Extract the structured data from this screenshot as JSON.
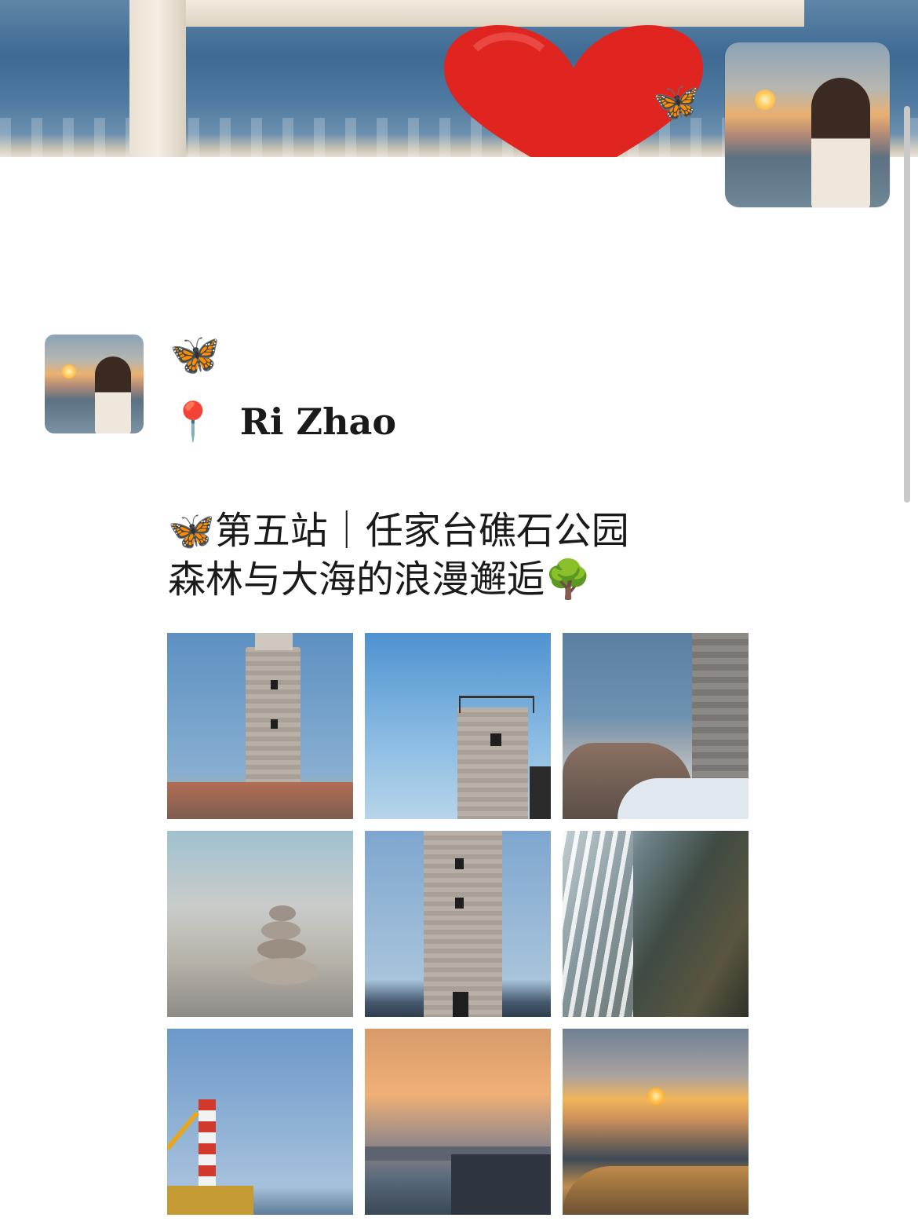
{
  "header": {
    "cover_decoration_icon": "butterfly-icon"
  },
  "post": {
    "name_icon": "butterfly-icon",
    "name_emoji": "🦋",
    "location": {
      "icon": "pin-icon",
      "pin_emoji": "📍",
      "text": "Ri Zhao"
    },
    "caption": {
      "line1_emoji": "🦋",
      "line1_text": "第五站｜任家台礁石公园",
      "line2_text": "森林与大海的浪漫邂逅",
      "line2_emoji": "🌳"
    },
    "photos": [
      {
        "subject": "lighthouse-stone-tower"
      },
      {
        "subject": "lighthouse-tower-top"
      },
      {
        "subject": "rocks-and-tower-wall"
      },
      {
        "subject": "stacked-stones"
      },
      {
        "subject": "lighthouse-close"
      },
      {
        "subject": "waves-on-rock"
      },
      {
        "subject": "red-white-lighthouse"
      },
      {
        "subject": "sunset-pier-fishing"
      },
      {
        "subject": "sunset-sea"
      }
    ]
  },
  "colors": {
    "accent_blue": "#2aa0e6",
    "text": "#1a1a1a",
    "background": "#ffffff"
  }
}
